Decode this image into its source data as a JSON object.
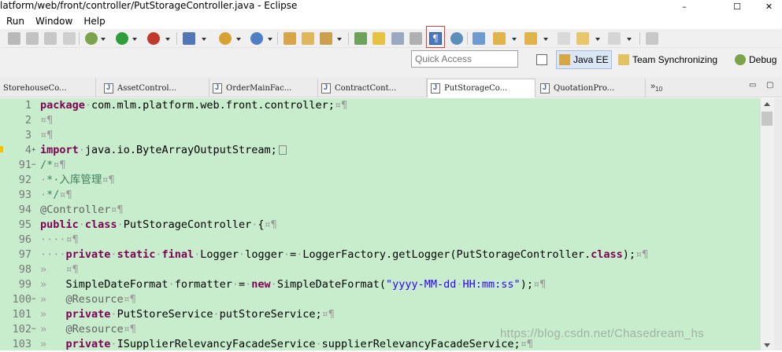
{
  "window": {
    "title": "latform/web/front/controller/PutStorageController.java - Eclipse",
    "minimize": "–",
    "maximize": "☐",
    "close": "✕"
  },
  "menu": [
    "Run",
    "Window",
    "Help"
  ],
  "toolbar": {
    "highlighted_button": "show-whitespace-characters",
    "pilcrow": "¶"
  },
  "quick_access": {
    "placeholder": "Quick Access"
  },
  "perspectives": [
    {
      "label": "Java EE",
      "active": true
    },
    {
      "label": "Team Synchronizing",
      "active": false
    },
    {
      "label": "Debug",
      "active": false
    }
  ],
  "tabs": [
    {
      "label": "StorehouseCo...",
      "active": false
    },
    {
      "label": "AssetControl...",
      "active": false
    },
    {
      "label": "OrderMainFac...",
      "active": false
    },
    {
      "label": "ContractCont...",
      "active": false
    },
    {
      "label": "PutStorageCo...",
      "active": true
    },
    {
      "label": "QuotationPro...",
      "active": false
    }
  ],
  "tabs_overflow": {
    "arrow": "»",
    "count": "10"
  },
  "editor": {
    "lines": [
      {
        "num": "1",
        "fold": "",
        "segments": [
          [
            "kw",
            "package"
          ],
          [
            "ws",
            "·"
          ],
          [
            "cls",
            "com.mlm.platform.web.front.controller;"
          ],
          [
            "ws",
            "¤¶"
          ]
        ]
      },
      {
        "num": "2",
        "fold": "",
        "segments": [
          [
            "ws",
            "¤¶"
          ]
        ]
      },
      {
        "num": "3",
        "fold": "",
        "segments": [
          [
            "ws",
            "¤¶"
          ]
        ]
      },
      {
        "num": "4",
        "fold": "+",
        "segments": [
          [
            "kw",
            "import"
          ],
          [
            "ws",
            "·"
          ],
          [
            "cls",
            "java.io.ByteArrayOutputStream;"
          ]
        ],
        "collapsed": true
      },
      {
        "num": "91",
        "fold": "−",
        "segments": [
          [
            "cmt",
            "/*"
          ],
          [
            "ws",
            "¤¶"
          ]
        ]
      },
      {
        "num": "92",
        "fold": "",
        "segments": [
          [
            "ws",
            "·"
          ],
          [
            "cmt",
            "*·入库管理"
          ],
          [
            "ws",
            "¤¶"
          ]
        ]
      },
      {
        "num": "93",
        "fold": "",
        "segments": [
          [
            "ws",
            "·"
          ],
          [
            "cmt",
            "*/"
          ],
          [
            "ws",
            "¤¶"
          ]
        ]
      },
      {
        "num": "94",
        "fold": "",
        "segments": [
          [
            "ann",
            "@Controller"
          ],
          [
            "ws",
            "¤¶"
          ]
        ]
      },
      {
        "num": "95",
        "fold": "",
        "segments": [
          [
            "kw",
            "public"
          ],
          [
            "ws",
            "·"
          ],
          [
            "kw",
            "class"
          ],
          [
            "ws",
            "·"
          ],
          [
            "cls",
            "PutStorageController"
          ],
          [
            "ws",
            "·"
          ],
          [
            "cls",
            "{"
          ],
          [
            "ws",
            "¤¶"
          ]
        ]
      },
      {
        "num": "96",
        "fold": "",
        "segments": [
          [
            "ws",
            "····¤¶"
          ]
        ]
      },
      {
        "num": "97",
        "fold": "",
        "segments": [
          [
            "ws",
            "····"
          ],
          [
            "kw",
            "private"
          ],
          [
            "ws",
            "·"
          ],
          [
            "kw",
            "static"
          ],
          [
            "ws",
            "·"
          ],
          [
            "kw",
            "final"
          ],
          [
            "ws",
            "·"
          ],
          [
            "cls",
            "Logger"
          ],
          [
            "ws",
            "·"
          ],
          [
            "cls",
            "logger"
          ],
          [
            "ws",
            "·"
          ],
          [
            "cls",
            "="
          ],
          [
            "ws",
            "·"
          ],
          [
            "cls",
            "LoggerFactory.getLogger(PutStorageController."
          ],
          [
            "kw",
            "class"
          ],
          [
            "cls",
            ");"
          ],
          [
            "ws",
            "¤¶"
          ]
        ]
      },
      {
        "num": "98",
        "fold": "",
        "segments": [
          [
            "ws",
            "»   ¤¶"
          ]
        ]
      },
      {
        "num": "99",
        "fold": "",
        "segments": [
          [
            "ws",
            "»   "
          ],
          [
            "cls",
            "SimpleDateFormat"
          ],
          [
            "ws",
            "·"
          ],
          [
            "cls",
            "formatter"
          ],
          [
            "ws",
            "·"
          ],
          [
            "cls",
            "="
          ],
          [
            "ws",
            "·"
          ],
          [
            "kw",
            "new"
          ],
          [
            "ws",
            "·"
          ],
          [
            "cls",
            "SimpleDateFormat("
          ],
          [
            "str",
            "\"yyyy-MM-dd"
          ],
          [
            "ws",
            "·"
          ],
          [
            "str",
            "HH:mm:ss\""
          ],
          [
            "cls",
            ");"
          ],
          [
            "ws",
            "¤¶"
          ]
        ]
      },
      {
        "num": "100",
        "fold": "−",
        "segments": [
          [
            "ws",
            "»   "
          ],
          [
            "ann",
            "@Resource"
          ],
          [
            "ws",
            "¤¶"
          ]
        ]
      },
      {
        "num": "101",
        "fold": "",
        "segments": [
          [
            "ws",
            "»   "
          ],
          [
            "kw",
            "private"
          ],
          [
            "ws",
            "·"
          ],
          [
            "cls",
            "PutStoreService"
          ],
          [
            "ws",
            "·"
          ],
          [
            "cls",
            "putStoreService;"
          ],
          [
            "ws",
            "¤¶"
          ]
        ]
      },
      {
        "num": "102",
        "fold": "−",
        "segments": [
          [
            "ws",
            "»   "
          ],
          [
            "ann",
            "@Resource"
          ],
          [
            "ws",
            "¤¶"
          ]
        ]
      },
      {
        "num": "103",
        "fold": "",
        "segments": [
          [
            "ws",
            "»   "
          ],
          [
            "kw",
            "private"
          ],
          [
            "ws",
            "·"
          ],
          [
            "cls",
            "ISupplierRelevancyFacadeService"
          ],
          [
            "ws",
            "·"
          ],
          [
            "cls",
            "supplierRelevancyFacadeService;"
          ],
          [
            "ws",
            "¤¶"
          ]
        ]
      }
    ]
  },
  "watermark": "https://blog.csdn.net/Chasedream_hs",
  "colors": {
    "editor_bg": "#c7edcc",
    "keyword": "#7f0055",
    "string": "#2a00ff",
    "comment": "#3f7f5f",
    "annotation": "#646464",
    "highlight": "#e53a36"
  }
}
